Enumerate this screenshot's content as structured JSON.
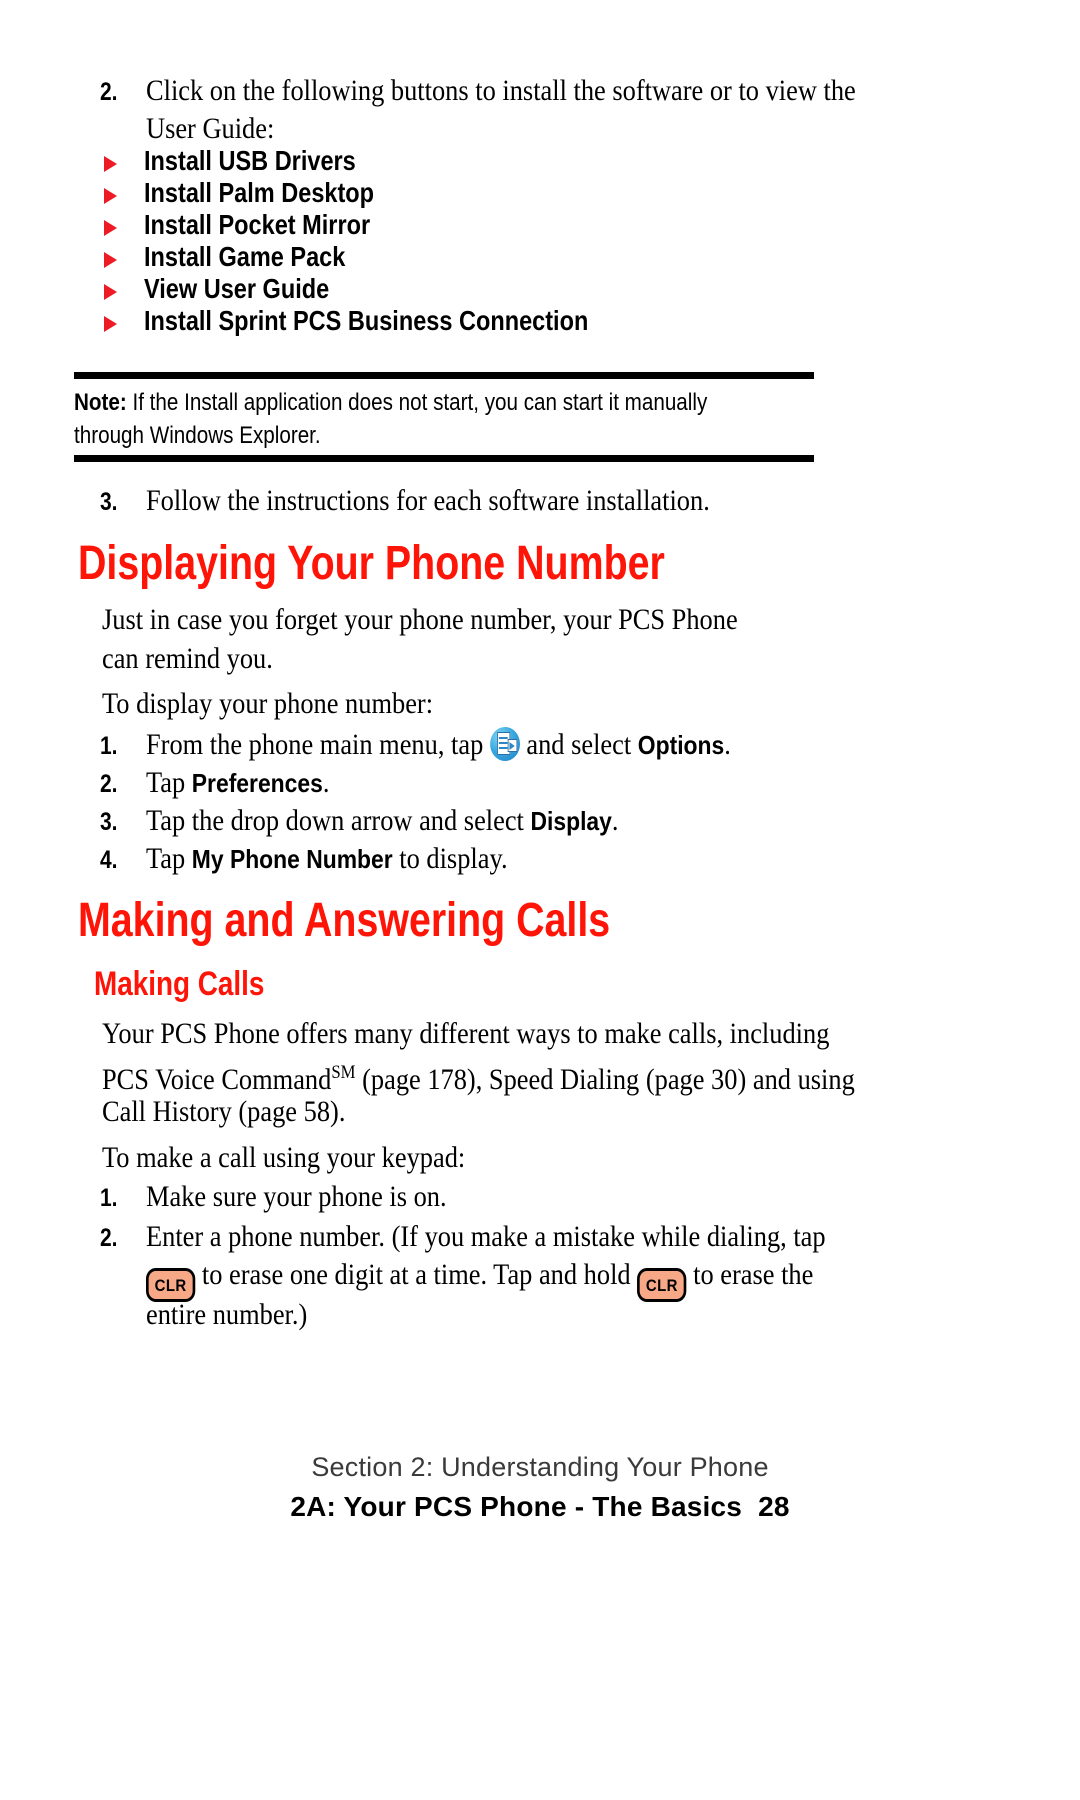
{
  "document": {
    "type": "user-manual-page",
    "accent_red": "#FF1408",
    "key_fill": "#F7A887",
    "icon_blue": "#3aa9e0"
  },
  "steps_install": {
    "item2": {
      "number": "2.",
      "line1": "Click on the following buttons to install the software or to view the",
      "line2": "User Guide:"
    },
    "bullets": [
      {
        "label": "Install USB Drivers"
      },
      {
        "label": "Install Palm Desktop"
      },
      {
        "label": "Install Pocket Mirror"
      },
      {
        "label": "Install Game Pack"
      },
      {
        "label": "View User Guide"
      },
      {
        "label": "Install Sprint PCS Business Connection"
      }
    ],
    "item3": {
      "number": "3.",
      "text": "Follow the instructions for each software installation."
    }
  },
  "note": {
    "label": "Note:",
    "text": " If the Install application does not start, you can start it manually through Windows Explorer."
  },
  "section_display": {
    "heading": "Displaying Your Phone Number",
    "intro": "Just in case you forget your phone number, your PCS Phone can remind you.",
    "lead_in": "To display your phone number:",
    "steps": [
      {
        "number": "1.",
        "pre": "From the phone main menu, tap",
        "icon": "phone-options-app-icon",
        "mid": "and select",
        "bold": "Options",
        "post": "."
      },
      {
        "number": "2.",
        "pre": "Tap",
        "bold": "Preferences",
        "post": "."
      },
      {
        "number": "3.",
        "pre": "Tap the drop down arrow and select",
        "bold": "Display",
        "post": "."
      },
      {
        "number": "4.",
        "pre": "Tap",
        "bold": "My Phone Number",
        "post": " to display."
      }
    ]
  },
  "section_calls": {
    "heading": "Making and Answering Calls",
    "subheading": "Making Calls",
    "para_line1": "Your PCS Phone offers many different ways to make calls, including",
    "para_line2_a": "PCS Voice Command",
    "para_line2_sm": "SM",
    "para_line2_b": " (page 178), Speed Dialing (page 30) and using",
    "para_line3": "Call History (page 58).",
    "lead_in": "To make a call using your keypad:",
    "step1": {
      "number": "1.",
      "text": "Make sure your phone is on."
    },
    "step2": {
      "number": "2.",
      "line1": "Enter a phone number. (If you make a mistake while dialing, tap",
      "key1": "CLR",
      "line2a": "to erase one digit at a time. Tap and hold",
      "key2": "CLR",
      "line2b": "to erase the",
      "line3": "entire number.)"
    }
  },
  "footer": {
    "line1": "Section 2: Understanding Your Phone",
    "line2": "2A: Your PCS Phone - The Basics",
    "page": "28"
  }
}
